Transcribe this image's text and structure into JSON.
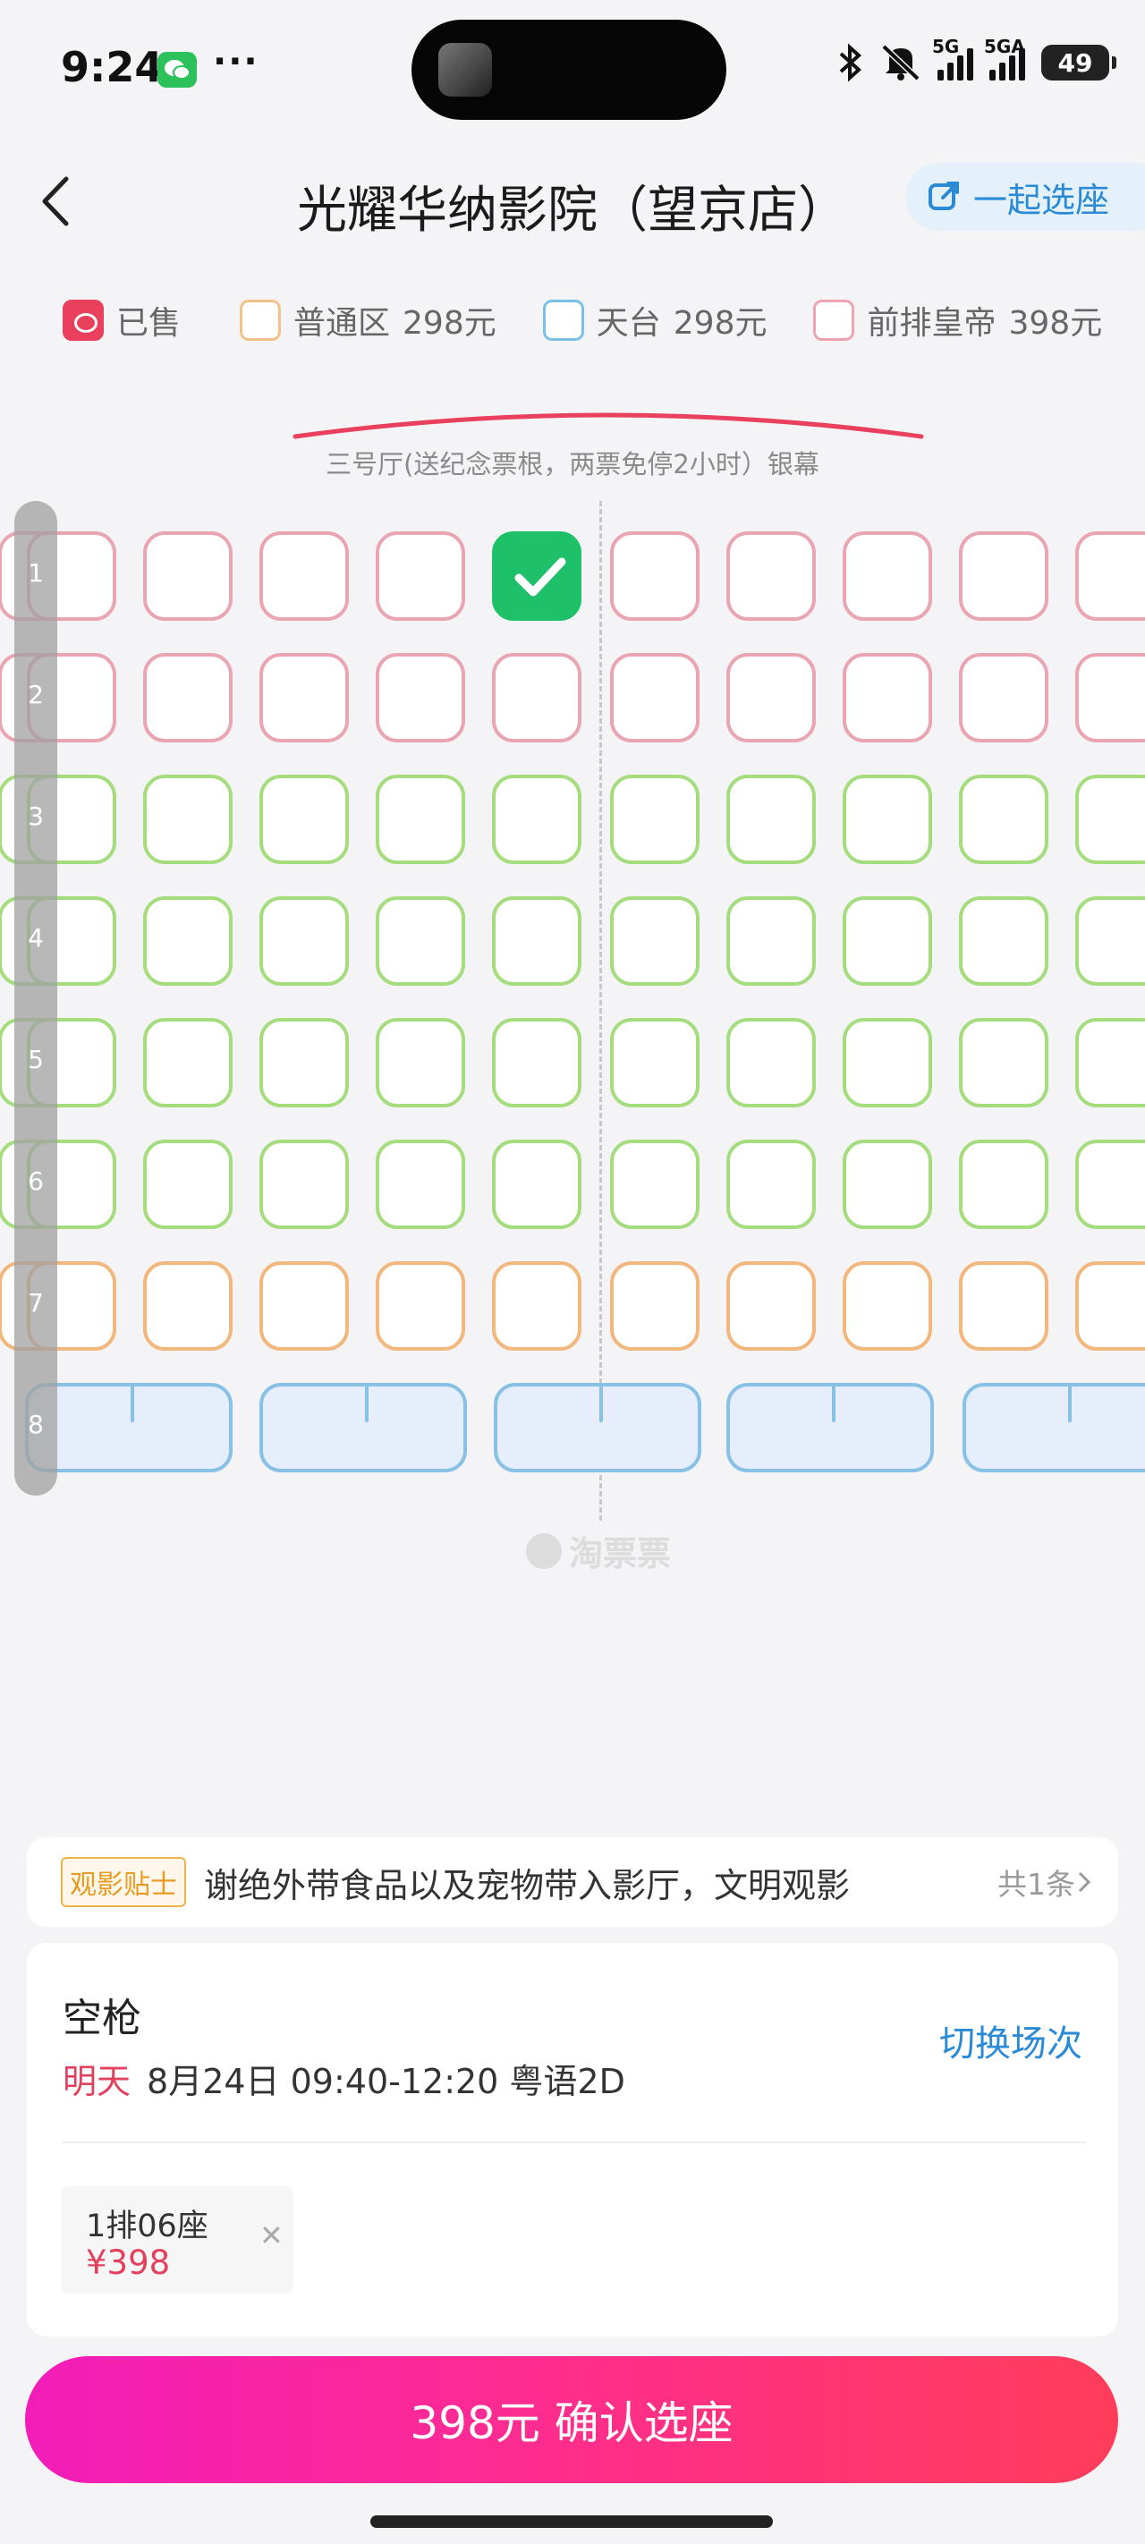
{
  "status_bar": {
    "time": "9:24",
    "more": "···",
    "net1": "5G",
    "net2": "5GA",
    "battery": "49"
  },
  "header": {
    "title": "光耀华纳影院（望京店）",
    "together_label": "一起选座"
  },
  "legend": [
    {
      "name": "已售",
      "price": "",
      "kind": "sold"
    },
    {
      "name": "普通区",
      "price": "298元",
      "color": "#f2c28a"
    },
    {
      "name": "天台",
      "price": "298元",
      "color": "#7cc0e8"
    },
    {
      "name": "前排皇帝",
      "price": "398元",
      "color": "#eda3b1"
    }
  ],
  "screen": {
    "label": "三号厅(送纪念票根，两票免停2小时）银幕"
  },
  "seatmap": {
    "rows": [
      "1",
      "2",
      "3",
      "4",
      "5",
      "6",
      "7",
      "8"
    ],
    "row_types": [
      "pink",
      "pink",
      "green",
      "green",
      "green",
      "green",
      "orange",
      "couple"
    ],
    "selected": {
      "row": 1,
      "col": 5
    },
    "colors": {
      "pink": "#e9a5b2",
      "green": "#a5dd7e",
      "orange": "#f2b77d",
      "couple": "#87c2e6",
      "selected": "#1ec16a"
    }
  },
  "watermark": "淘票票",
  "tips": {
    "tag": "观影贴士",
    "text": "谢绝外带食品以及宠物带入影厅，文明观影",
    "count": "共1条"
  },
  "order": {
    "movie": "空枪",
    "day": "明天",
    "time": "8月24日 09:40-12:20 粤语2D",
    "switch_label": "切换场次",
    "ticket": {
      "seat": "1排06座",
      "price": "¥398"
    }
  },
  "confirm": {
    "label": "398元 确认选座"
  }
}
